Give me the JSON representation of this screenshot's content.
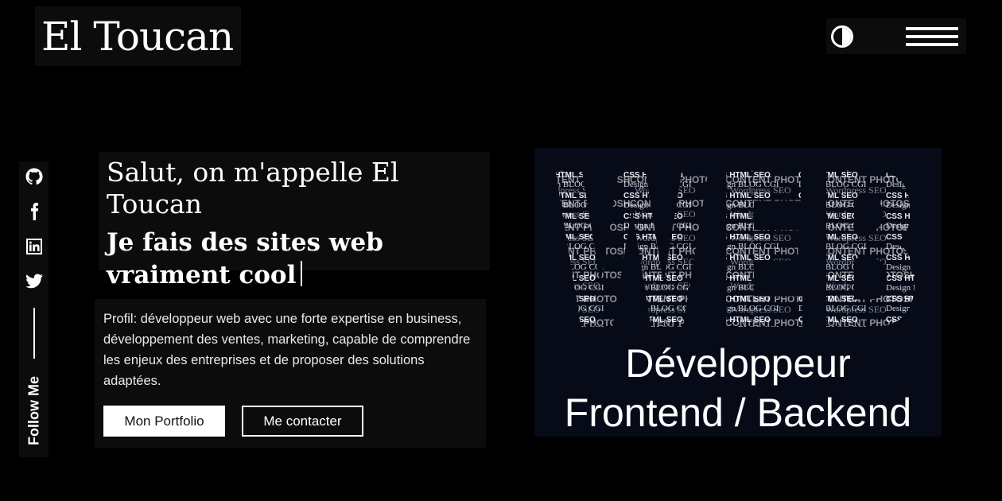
{
  "header": {
    "logo": "El Toucan",
    "theme_toggle": "contrast-icon",
    "menu": "hamburger-menu-icon"
  },
  "social": {
    "links": [
      "github-icon",
      "facebook-icon",
      "linkedin-icon",
      "twitter-icon"
    ],
    "follow_label": "Follow Me"
  },
  "hero": {
    "greeting": "Salut, on m'appelle El Toucan",
    "tagline": "Je fais des sites web vraiment cool"
  },
  "profile": {
    "text": "Profil: développeur web avec une forte expertise en business, développement des ventes, marketing, capable de comprendre les enjeux des entreprises et de proposer des solutions adaptées.",
    "portfolio_button": "Mon Portfolio",
    "contact_button": "Me contacter"
  },
  "banner": {
    "big_word": "WEB",
    "words": [
      "CSS",
      "HTML",
      "Design",
      "CONTENT",
      "PHOTOSHOP",
      "Wordpress",
      "SEO",
      "BLOG",
      "CGI",
      "PHOTOS"
    ],
    "line1": "Développeur",
    "line2": "Frontend / Backend"
  },
  "colors": {
    "background": "#000000",
    "panel": "#0c0c0c",
    "banner_bg": "#070b17"
  }
}
